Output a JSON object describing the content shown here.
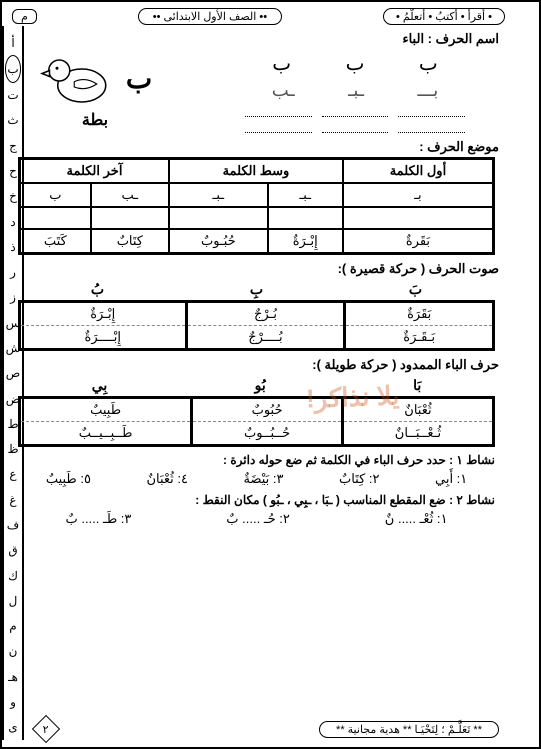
{
  "header": {
    "right": "• أقرأ • أكتبُ • أتعلّمُ •",
    "mid": "•• الصف الأول الابتدائى ••",
    "left": "م"
  },
  "alphabet": [
    "أ",
    "ب",
    "ت",
    "ث",
    "ج",
    "ح",
    "خ",
    "د",
    "ذ",
    "ر",
    "ز",
    "س",
    "ش",
    "ص",
    "ض",
    "ط",
    "ظ",
    "ع",
    "غ",
    "ف",
    "ق",
    "ك",
    "ل",
    "م",
    "ن",
    "هـ",
    "و",
    "ى"
  ],
  "letter_name_label": "اسم الحرف :   الباء",
  "forms": {
    "iso": "ب",
    "end": "ـب",
    "mid": "ـبـ",
    "begin": "بـ"
  },
  "trace": {
    "t1": "بـــ",
    "t2": "ـبـ",
    "t3": "ـب"
  },
  "image_letter": "ب",
  "image_word": "بطة",
  "pos": {
    "title": "موضع الحرف :",
    "h1": "أول الكلمة",
    "h2": "وسط الكلمة",
    "h3": "آخر الكلمة",
    "r1": [
      "بـ",
      "ـبـ",
      "ـب",
      "ب"
    ],
    "r2": [
      "بَقَرةٌ",
      "إِبْـرَةٌ",
      "حُبُـوبٌ",
      "كِتَابٌ",
      "كَتَبَ"
    ]
  },
  "sound": {
    "title": "صوت الحرف ( حركة قصيرة ):",
    "h": [
      "بَ",
      "بِ",
      "بُ"
    ],
    "w": [
      "بَقَرَةٌ",
      "بُـرْجٌ",
      "إِبْـرَةٌ"
    ],
    "t": [
      "بَـقَـرَةٌ",
      "بُــــرْجٌ",
      "إِبْــــرَةٌ"
    ]
  },
  "long": {
    "title": "حرف الباء الممدود ( حركة طويلة ):",
    "h": [
      "بَا",
      "بُو",
      "بِي"
    ],
    "w": [
      "ثُعْبَانٌ",
      "حُبُوبٌ",
      "طَبِيبٌ"
    ],
    "t": [
      "ثُـعْــبَــانٌ",
      "حُــبُــوبٌ",
      "طَــبِــيــبٌ"
    ]
  },
  "ex1": {
    "title": "نشاط ١ : حدد حرف الباء في الكلمة ثم ضع حوله دائرة :",
    "w": [
      "١: أَبِي",
      "٢: كِتَابٌ",
      "٣: بَيْضَةٌ",
      "٤: ثُعْبَانٌ",
      "٥: طَبِيبٌ"
    ]
  },
  "ex2": {
    "title": "نشاط ٢ : ضع المقطع المناسب ( ـبَا ، ـبِي ، ـبُو ) مكان النقط :",
    "w": [
      "١: ثُعْـ ..... نٌ",
      "٢: حُـ ..... بٌ",
      "٣: طَـ ..... بٌ"
    ]
  },
  "footer": {
    "text": "** تَعَلَّـمْ ؛ لِتَحْيَـا ** هدية مجانية **",
    "page": "٢"
  },
  "watermark": "يلا نذاكر!"
}
